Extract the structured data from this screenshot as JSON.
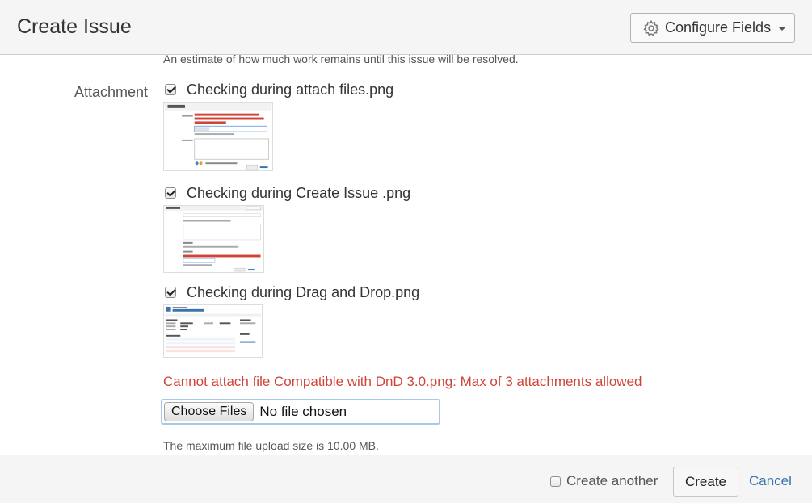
{
  "dialog": {
    "title": "Create Issue",
    "configure_fields_label": "Configure Fields",
    "configure_icon": "gear-icon"
  },
  "form": {
    "estimate_help": "An estimate of how much work remains until this issue will be resolved.",
    "attachment_label": "Attachment",
    "attachments": [
      {
        "name": "Checking during attach files.png",
        "checked": true
      },
      {
        "name": "Checking during Create Issue .png",
        "checked": true
      },
      {
        "name": "Checking during Drag and Drop.png",
        "checked": true
      }
    ],
    "error_message": "Cannot attach file Compatible with DnD 3.0.png: Max of 3 attachments allowed",
    "file_input": {
      "button_label": "Choose Files",
      "status_text": "No file chosen"
    },
    "max_size_note": "The maximum file upload size is 10.00 MB."
  },
  "footer": {
    "create_another_label": "Create another",
    "create_another_checked": false,
    "create_label": "Create",
    "cancel_label": "Cancel"
  },
  "colors": {
    "error": "#d04437",
    "link": "#3b73af",
    "header_bg": "#f5f5f5"
  }
}
